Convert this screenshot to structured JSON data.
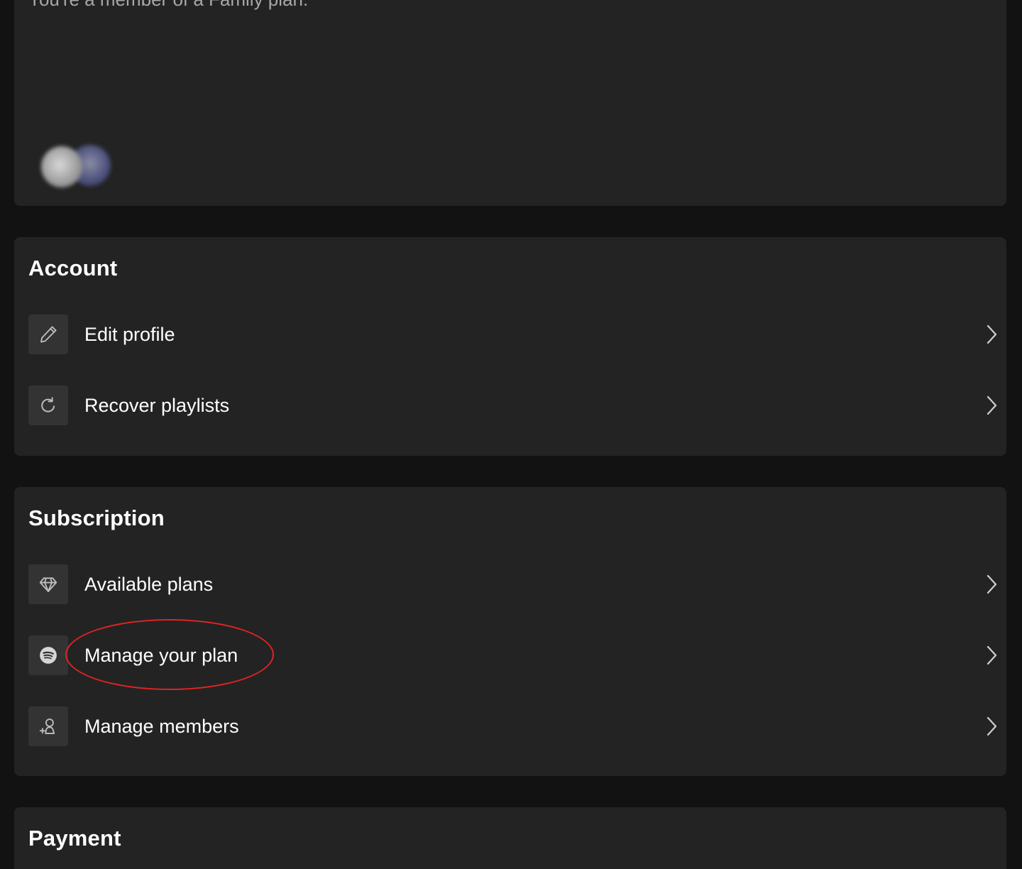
{
  "plan": {
    "subtitle": "You're a member of a Family plan."
  },
  "account": {
    "title": "Account",
    "items": [
      {
        "label": "Edit profile",
        "icon": "pencil-icon"
      },
      {
        "label": "Recover playlists",
        "icon": "refresh-icon"
      }
    ]
  },
  "subscription": {
    "title": "Subscription",
    "items": [
      {
        "label": "Available plans",
        "icon": "diamond-icon"
      },
      {
        "label": "Manage your plan",
        "icon": "spotify-logo-icon"
      },
      {
        "label": "Manage members",
        "icon": "add-person-icon"
      }
    ]
  },
  "payment": {
    "title": "Payment"
  },
  "colors": {
    "background": "#121212",
    "card": "#232323",
    "icon_tile": "#333333",
    "annotation": "#e02424"
  }
}
